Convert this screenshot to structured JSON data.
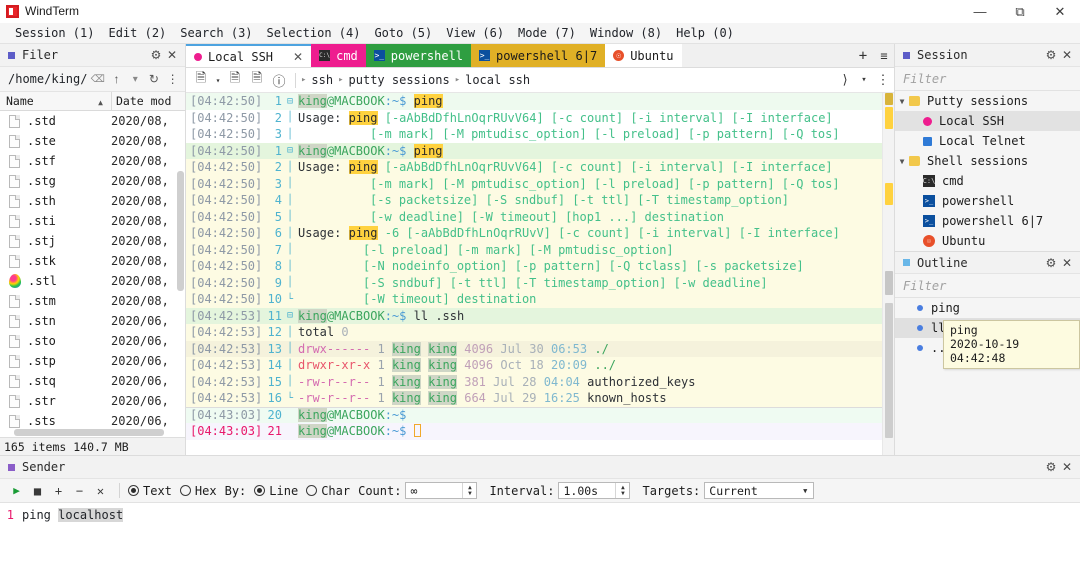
{
  "window": {
    "title": "WindTerm",
    "logo_icon": "windterm-logo",
    "minimize_icon": "minimize-icon",
    "maximize_icon": "restore-icon",
    "close_icon": "close-icon"
  },
  "menubar": [
    {
      "label": "Session (1)",
      "accel": "1"
    },
    {
      "label": "Edit (2)",
      "accel": "2"
    },
    {
      "label": "Search (3)",
      "accel": "3"
    },
    {
      "label": "Selection (4)",
      "accel": "4"
    },
    {
      "label": "Goto (5)",
      "accel": "5"
    },
    {
      "label": "View (6)",
      "accel": "6"
    },
    {
      "label": "Mode (7)",
      "accel": "7"
    },
    {
      "label": "Window (8)",
      "accel": "8"
    },
    {
      "label": "Help (0)",
      "accel": "0"
    }
  ],
  "filer": {
    "title": "Filer",
    "settings_icon": "gear-icon",
    "close_icon": "close-icon",
    "path": "/home/king/",
    "clear_icon": "backspace-icon",
    "up_icon": "arrow-up-icon",
    "dropdown_icon": "chevron-down-icon",
    "refresh_icon": "refresh-icon",
    "more_icon": "more-vertical-icon",
    "columns": [
      "Name",
      "Date mod"
    ],
    "sort_icon": "sort-asc-icon",
    "rows": [
      {
        "name": ".std",
        "date": "2020/08,",
        "icon": "file-icon"
      },
      {
        "name": ".ste",
        "date": "2020/08,",
        "icon": "file-icon"
      },
      {
        "name": ".stf",
        "date": "2020/08,",
        "icon": "file-icon"
      },
      {
        "name": ".stg",
        "date": "2020/08,",
        "icon": "file-icon"
      },
      {
        "name": ".sth",
        "date": "2020/08,",
        "icon": "file-icon"
      },
      {
        "name": ".sti",
        "date": "2020/08,",
        "icon": "file-icon"
      },
      {
        "name": ".stj",
        "date": "2020/08,",
        "icon": "file-icon"
      },
      {
        "name": ".stk",
        "date": "2020/08,",
        "icon": "file-icon"
      },
      {
        "name": ".stl",
        "date": "2020/08,",
        "icon": "stl-file-icon"
      },
      {
        "name": ".stm",
        "date": "2020/08,",
        "icon": "file-icon"
      },
      {
        "name": ".stn",
        "date": "2020/06,",
        "icon": "file-icon"
      },
      {
        "name": ".sto",
        "date": "2020/06,",
        "icon": "file-icon"
      },
      {
        "name": ".stp",
        "date": "2020/06,",
        "icon": "file-icon"
      },
      {
        "name": ".stq",
        "date": "2020/06,",
        "icon": "file-icon"
      },
      {
        "name": ".str",
        "date": "2020/06,",
        "icon": "file-icon"
      },
      {
        "name": ".sts",
        "date": "2020/06,",
        "icon": "file-icon"
      }
    ],
    "status": "165 items 140.7 MB"
  },
  "tabs": [
    {
      "label": "Local SSH",
      "icon": "pink-dot-icon",
      "active": true,
      "closeable": true,
      "color": "#ffffff"
    },
    {
      "label": "cmd",
      "icon": "cmd-icon",
      "active": false,
      "color": "#ee1d8f"
    },
    {
      "label": "powershell",
      "icon": "powershell-icon",
      "active": false,
      "color": "#2f9e41"
    },
    {
      "label": "powershell 6|7",
      "icon": "powershell-icon",
      "active": false,
      "color": "#e0b026"
    },
    {
      "label": "Ubuntu",
      "icon": "ubuntu-icon",
      "active": false,
      "color": "#ffffff"
    }
  ],
  "tabbar": {
    "new_tab_icon": "plus-icon",
    "tab_list_icon": "list-icon"
  },
  "terminal_toolbar": {
    "new_icon": "new-session-icon",
    "dropdown_icon": "chevron-down-icon",
    "close_session_icon": "close-session-icon",
    "duplicate_icon": "duplicate-session-icon",
    "info_icon": "info-icon",
    "breadcrumb": [
      "ssh",
      "putty sessions",
      "local ssh"
    ],
    "expand_icon": "chevron-right-icon",
    "more_dropdown_icon": "chevron-down-icon",
    "more_icon": "more-vertical-icon"
  },
  "terminal": {
    "lines": [
      {
        "ts": "[04:42:50]",
        "n": "1",
        "bg": "greenish",
        "fold": "open",
        "type": "prompt",
        "cmd": "ping"
      },
      {
        "ts": "[04:42:50]",
        "n": "2",
        "bg": "white",
        "type": "usage1"
      },
      {
        "ts": "[04:42:50]",
        "n": "3",
        "bg": "white",
        "type": "clip3"
      },
      {
        "ts": "[04:42:50]",
        "n": "1",
        "bg": "greenhi",
        "fold": "open",
        "type": "prompt",
        "cmd": "ping"
      },
      {
        "ts": "[04:42:50]",
        "n": "2",
        "bg": "cream",
        "type": "usage1"
      },
      {
        "ts": "[04:42:50]",
        "n": "3",
        "bg": "cream",
        "type": "line3"
      },
      {
        "ts": "[04:42:50]",
        "n": "4",
        "bg": "cream",
        "type": "line4"
      },
      {
        "ts": "[04:42:50]",
        "n": "5",
        "bg": "cream",
        "type": "line5"
      },
      {
        "ts": "[04:42:50]",
        "n": "6",
        "bg": "cream",
        "type": "usage6"
      },
      {
        "ts": "[04:42:50]",
        "n": "7",
        "bg": "cream",
        "type": "line7"
      },
      {
        "ts": "[04:42:50]",
        "n": "8",
        "bg": "cream",
        "type": "line8"
      },
      {
        "ts": "[04:42:50]",
        "n": "9",
        "bg": "cream",
        "type": "line9"
      },
      {
        "ts": "[04:42:50]",
        "n": "10",
        "bg": "cream",
        "fold": "end",
        "type": "line10"
      },
      {
        "ts": "[04:42:53]",
        "n": "11",
        "bg": "greenhi",
        "fold": "open",
        "type": "prompt_ll",
        "cmd": "ll",
        "arg": ".ssh"
      },
      {
        "ts": "[04:42:53]",
        "n": "12",
        "bg": "cream",
        "type": "total"
      },
      {
        "ts": "[04:42:53]",
        "n": "13",
        "bg": "creamdk",
        "type": "ls",
        "perm": "drwx------",
        "links": "1",
        "owner": "king",
        "group": "king",
        "size": "4096",
        "mon": "Jul",
        "day": "30",
        "time": "06:53",
        "file": "./"
      },
      {
        "ts": "[04:42:53]",
        "n": "14",
        "bg": "cream",
        "type": "ls",
        "perm": "drwxr-xr-x",
        "links": "1",
        "owner": "king",
        "group": "king",
        "size": "4096",
        "mon": "Oct",
        "day": "18",
        "time": "20:09",
        "file": "../"
      },
      {
        "ts": "[04:42:53]",
        "n": "15",
        "bg": "cream",
        "type": "ls",
        "perm": "-rw-r--r--",
        "links": "1",
        "owner": "king",
        "group": "king",
        "size": "381",
        "mon": "Jul",
        "day": "28",
        "time": "04:04",
        "file": "authorized_keys"
      },
      {
        "ts": "[04:42:53]",
        "n": "16",
        "bg": "cream",
        "fold": "end",
        "type": "ls",
        "perm": "-rw-r--r--",
        "links": "1",
        "owner": "king",
        "group": "king",
        "size": "664",
        "mon": "Jul",
        "day": "29",
        "time": "16:25",
        "file": "known_hosts"
      },
      {
        "ts": "[04:43:03]",
        "n": "20",
        "bg": "mint",
        "type": "prompt_empty"
      },
      {
        "ts": "[04:43:03]",
        "n": "21",
        "bg": "lilac",
        "ts_red": true,
        "type": "prompt_cursor"
      }
    ],
    "prompt_user": "king",
    "prompt_at": "@MACBOOK",
    "prompt_path": ":~$",
    "usage_label": "Usage:",
    "usage_cmd": "ping",
    "usage1_opts": "[-aAbBdDfhLnOqrRUvV64] [-c count] [-i interval] [-I interface]",
    "line3_opts": "[-m mark] [-M pmtudisc_option] [-l preload] [-p pattern] [-Q tos]",
    "line4_opts": "[-s packetsize] [-S sndbuf] [-t ttl] [-T timestamp_option]",
    "line5_opts": "[-w deadline] [-W timeout] [hop1 ...] destination",
    "usage6_opts": "-6 [-aAbBdDfhLnOqrRUvV] [-c count] [-i interval] [-I interface]",
    "line7_opts": "[-l preload] [-m mark] [-M pmtudisc_option]",
    "line8_opts": "[-N nodeinfo_option] [-p pattern] [-Q tclass] [-s packetsize]",
    "line9_opts": "[-S sndbuf] [-t ttl] [-T timestamp_option] [-w deadline]",
    "line10_opts": "[-W timeout] destination",
    "total_label": "total",
    "total_value": "0"
  },
  "session_panel": {
    "title": "Session",
    "settings_icon": "gear-icon",
    "close_icon": "close-icon",
    "filter_placeholder": "Filter",
    "groups": [
      {
        "label": "Putty sessions",
        "expanded": true,
        "icon": "folder-icon",
        "items": [
          {
            "label": "Local SSH",
            "icon": "pink-dot-icon",
            "selected": true
          },
          {
            "label": "Local Telnet",
            "icon": "blue-square-icon",
            "selected": false
          }
        ]
      },
      {
        "label": "Shell sessions",
        "expanded": true,
        "icon": "folder-icon",
        "items": [
          {
            "label": "cmd",
            "icon": "cmd-icon",
            "selected": false
          },
          {
            "label": "powershell",
            "icon": "powershell-icon",
            "selected": false
          },
          {
            "label": "powershell 6|7",
            "icon": "powershell-icon",
            "selected": false
          },
          {
            "label": "Ubuntu",
            "icon": "ubuntu-icon",
            "selected": false
          }
        ]
      }
    ]
  },
  "outline_panel": {
    "title": "Outline",
    "settings_icon": "gear-icon",
    "close_icon": "close-icon",
    "filter_placeholder": "Filter",
    "items": [
      {
        "label": "ping",
        "selected": false
      },
      {
        "label": "ll",
        "selected": true
      },
      {
        "label": "..",
        "selected": false
      }
    ],
    "tooltip": {
      "line1": "ping",
      "line2": "2020-10-19 04:42:48"
    }
  },
  "sender": {
    "title": "Sender",
    "settings_icon": "gear-icon",
    "close_icon": "close-icon",
    "play_icon": "play-icon",
    "stop_icon": "stop-icon",
    "add_icon": "plus-icon",
    "remove_icon": "minus-icon",
    "clear_icon": "close-icon",
    "text_label": "Text",
    "hex_label": "Hex",
    "mode_selected": "Text",
    "by_label": "By:",
    "line_label": "Line",
    "char_label": "Char",
    "by_selected": "Line",
    "count_label": "Count:",
    "count_value": "∞",
    "interval_label": "Interval:",
    "interval_value": "1.00s",
    "targets_label": "Targets:",
    "targets_value": "Current",
    "editor": {
      "line_number": "1",
      "text_cmd": "ping",
      "text_arg": "localhost"
    }
  }
}
